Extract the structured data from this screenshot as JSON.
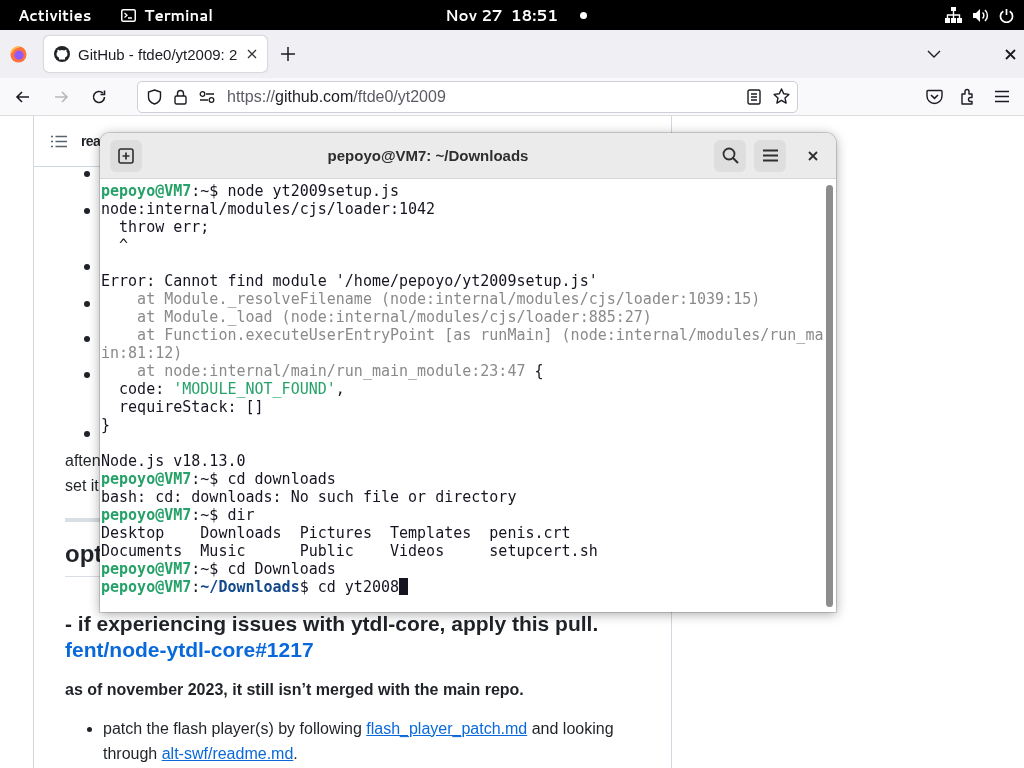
{
  "top_bar": {
    "activities": "Activities",
    "app": "Terminal",
    "clock": "Nov 27  18:51"
  },
  "browser": {
    "tabs": [
      {
        "title": "GitHub - ftde0/yt2009: 2",
        "selected": true
      }
    ],
    "nav_buttons": [
      {
        "kind": "back",
        "disabled": false
      },
      {
        "kind": "forward",
        "disabled": true
      },
      {
        "kind": "reload",
        "disabled": false
      }
    ],
    "url": [
      {
        "t": "https://",
        "kind": "dim"
      },
      {
        "t": "github.com",
        "kind": "host"
      },
      {
        "t": "/ftde0/yt2009",
        "kind": "dim"
      }
    ]
  },
  "readme": {
    "header": "rea",
    "fragments": [
      "aften",
      "set it"
    ],
    "section_heading": "opt",
    "pull_heading": "- if experiencing issues with ytdl-core, apply this pull.",
    "pull_link": "fent/node-ytdl-core#1217",
    "note": "as of november 2023, it still isn’t merged with the main repo.",
    "list": [
      {
        "parts": [
          {
            "t": "patch the flash player(s) by following ",
            "link": false
          },
          {
            "t": "flash_player_patch.md",
            "link": true
          },
          {
            "t": " and looking through ",
            "link": false
          },
          {
            "t": "alt-swf/readme.md",
            "link": true
          },
          {
            "t": ".",
            "link": false
          }
        ]
      }
    ]
  },
  "terminal": {
    "title": "pepoyo@VM7: ~/Downloads",
    "lines": [
      {
        "kind": "text",
        "segments": [
          {
            "t": "pepoyo@VM7",
            "kind": "user"
          },
          {
            "t": ":~$ node yt2009setup.js",
            "kind": "plain"
          }
        ]
      },
      {
        "kind": "text",
        "segments": [
          {
            "t": "node:internal/modules/cjs/loader:1042",
            "kind": "plain"
          }
        ]
      },
      {
        "kind": "text",
        "segments": [
          {
            "t": "  throw err;",
            "kind": "plain"
          }
        ]
      },
      {
        "kind": "text",
        "segments": [
          {
            "t": "  ^",
            "kind": "plain"
          }
        ]
      },
      {
        "kind": "blank"
      },
      {
        "kind": "text",
        "segments": [
          {
            "t": "Error: Cannot find module '/home/pepoyo/yt2009setup.js'",
            "kind": "plain"
          }
        ]
      },
      {
        "kind": "text",
        "segments": [
          {
            "t": "    at Module._resolveFilename (node:internal/modules/cjs/loader:1039:15)",
            "kind": "dim"
          }
        ]
      },
      {
        "kind": "text",
        "segments": [
          {
            "t": "    at Module._load (node:internal/modules/cjs/loader:885:27)",
            "kind": "dim"
          }
        ]
      },
      {
        "kind": "text",
        "segments": [
          {
            "t": "    at Function.executeUserEntryPoint [as runMain] (node:internal/modules/run_ma",
            "kind": "dim"
          }
        ]
      },
      {
        "kind": "text",
        "segments": [
          {
            "t": "in:81:12)",
            "kind": "dim"
          }
        ]
      },
      {
        "kind": "text",
        "segments": [
          {
            "t": "    at node:internal/main/run_main_module:23:47",
            "kind": "dim"
          },
          {
            "t": " {",
            "kind": "plain"
          }
        ]
      },
      {
        "kind": "text",
        "segments": [
          {
            "t": "  code: ",
            "kind": "plain"
          },
          {
            "t": "'MODULE_NOT_FOUND'",
            "kind": "string"
          },
          {
            "t": ",",
            "kind": "plain"
          }
        ]
      },
      {
        "kind": "text",
        "segments": [
          {
            "t": "  requireStack: []",
            "kind": "plain"
          }
        ]
      },
      {
        "kind": "text",
        "segments": [
          {
            "t": "}",
            "kind": "plain"
          }
        ]
      },
      {
        "kind": "blank"
      },
      {
        "kind": "text",
        "segments": [
          {
            "t": "Node.js v18.13.0",
            "kind": "plain"
          }
        ]
      },
      {
        "kind": "text",
        "segments": [
          {
            "t": "pepoyo@VM7",
            "kind": "user"
          },
          {
            "t": ":~$ cd downloads",
            "kind": "plain"
          }
        ]
      },
      {
        "kind": "text",
        "segments": [
          {
            "t": "bash: cd: downloads: No such file or directory",
            "kind": "plain"
          }
        ]
      },
      {
        "kind": "text",
        "segments": [
          {
            "t": "pepoyo@VM7",
            "kind": "user"
          },
          {
            "t": ":~$ dir",
            "kind": "plain"
          }
        ]
      },
      {
        "kind": "text",
        "segments": [
          {
            "t": "Desktop    Downloads  Pictures  Templates  penis.crt",
            "kind": "plain"
          }
        ]
      },
      {
        "kind": "text",
        "segments": [
          {
            "t": "Documents  Music      Public    Videos     setupcert.sh",
            "kind": "plain"
          }
        ]
      },
      {
        "kind": "text",
        "segments": [
          {
            "t": "pepoyo@VM7",
            "kind": "user"
          },
          {
            "t": ":~$ cd Downloads",
            "kind": "plain"
          }
        ]
      },
      {
        "kind": "prompt",
        "segments": [
          {
            "t": "pepoyo@VM7",
            "kind": "user"
          },
          {
            "t": ":",
            "kind": "plain"
          },
          {
            "t": "~/Downloads",
            "kind": "path"
          },
          {
            "t": "$ cd yt2008",
            "kind": "plain"
          }
        ]
      }
    ]
  }
}
